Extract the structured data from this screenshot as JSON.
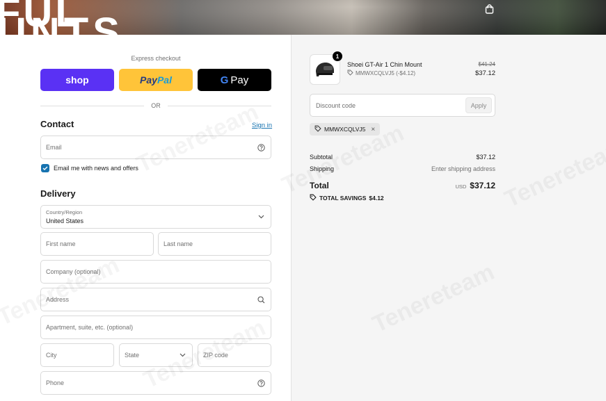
{
  "header": {
    "banner_text_1": "FUL",
    "banner_text_2": "UNTS",
    "cart_icon": "shopping-bag-icon"
  },
  "express": {
    "label": "Express checkout",
    "shop_label": "shop",
    "paypal_label_1": "Pay",
    "paypal_label_2": "Pal",
    "gpay_g": "G",
    "gpay_label": "Pay",
    "or_label": "OR"
  },
  "contact": {
    "title": "Contact",
    "sign_in": "Sign in",
    "email_placeholder": "Email",
    "newsletter_label": "Email me with news and offers",
    "newsletter_checked": true
  },
  "delivery": {
    "title": "Delivery",
    "country_label": "Country/Region",
    "country_value": "United States",
    "first_name": "First name",
    "last_name": "Last name",
    "company": "Company (optional)",
    "address": "Address",
    "apartment": "Apartment, suite, etc. (optional)",
    "city": "City",
    "state": "State",
    "zip": "ZIP code",
    "phone": "Phone"
  },
  "summary": {
    "item": {
      "quantity": "1",
      "name": "Shoei GT-Air 1 Chin Mount",
      "discount_code": "MMWXCQLVJ5 (-$4.12)",
      "old_price": "$41.24",
      "price": "$37.12"
    },
    "discount_placeholder": "Discount code",
    "apply_label": "Apply",
    "applied_code": "MMWXCQLVJ5",
    "subtotal_label": "Subtotal",
    "subtotal_value": "$37.12",
    "shipping_label": "Shipping",
    "shipping_value": "Enter shipping address",
    "total_label": "Total",
    "currency": "USD",
    "total_value": "$37.12",
    "savings_label": "TOTAL SAVINGS",
    "savings_value": "$4.12"
  },
  "watermark": "Tenereteam",
  "colors": {
    "shop": "#5a31f4",
    "paypal": "#ffc439",
    "gpay": "#000000",
    "link": "#1773b0"
  }
}
